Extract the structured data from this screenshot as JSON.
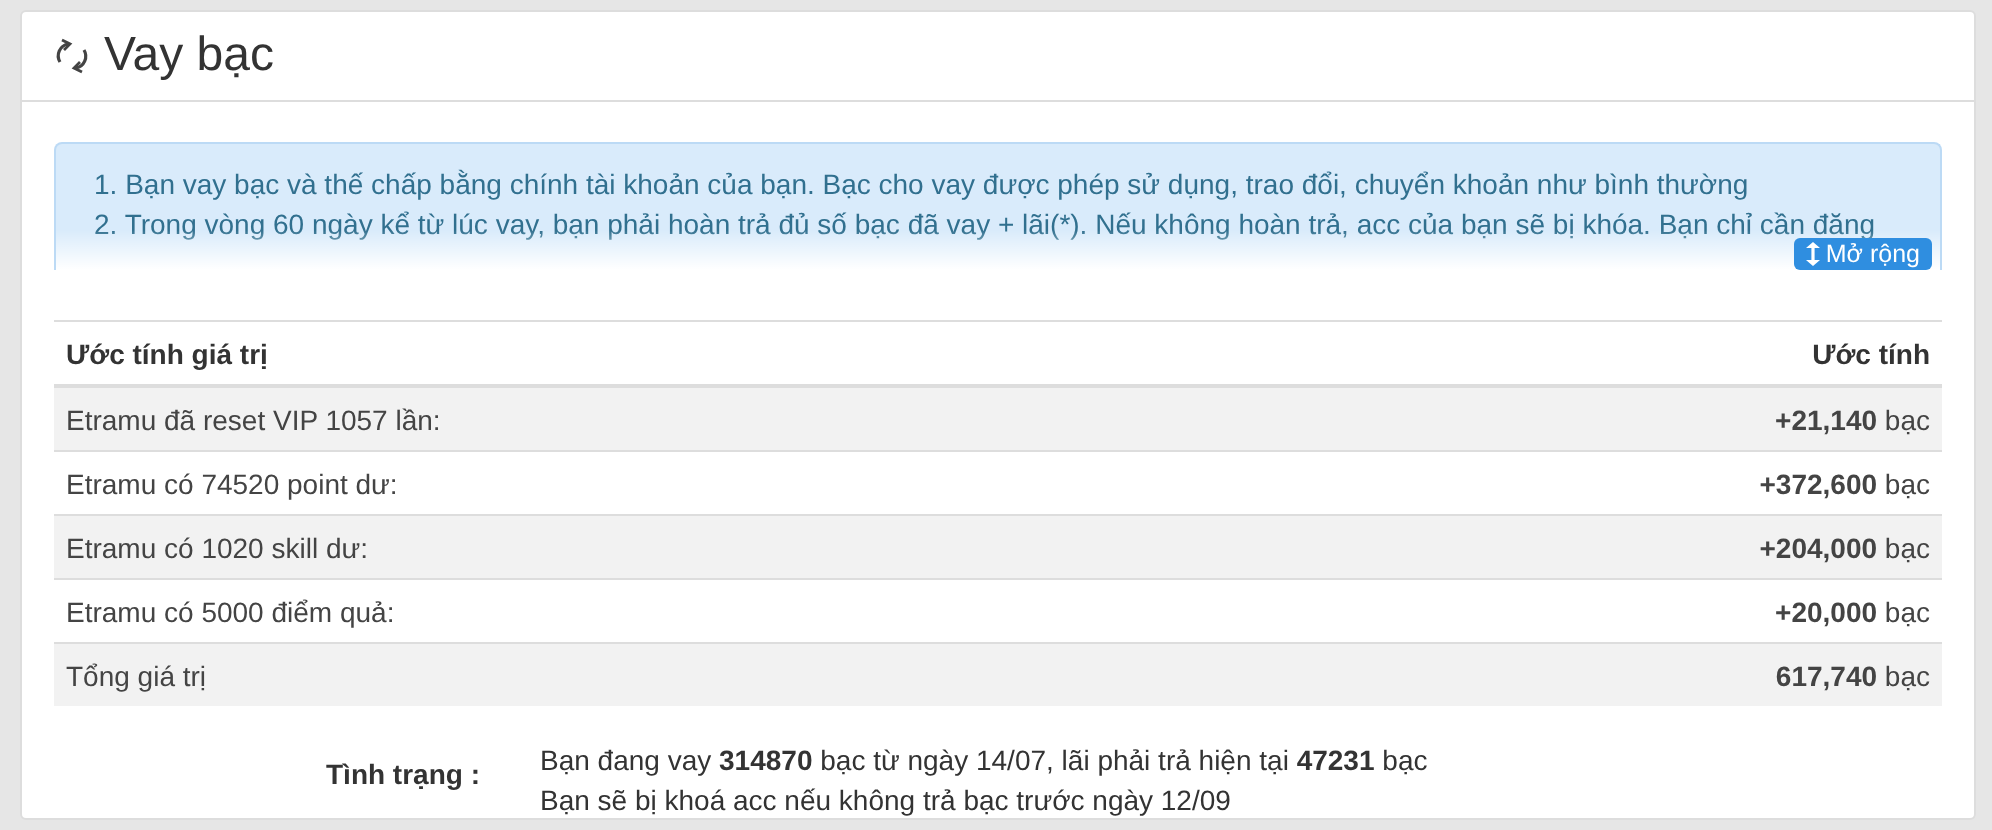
{
  "panel": {
    "title": "Vay bạc"
  },
  "notice": {
    "lines": [
      "1. Bạn vay bạc và thế chấp bằng chính tài khoản của bạn. Bạc cho vay được phép sử dụng, trao đổi, chuyển khoản như bình thường",
      "2. Trong vòng 60 ngày kể từ lúc vay, bạn phải hoàn trả đủ số bạc đã vay + lãi(*). Nếu không hoàn trả, acc của bạn sẽ bị khóa. Bạn chỉ cần đăng"
    ],
    "expand_button": "Mở rộng"
  },
  "table": {
    "columns": [
      "Ước tính giá trị",
      "Ước tính"
    ],
    "rows": [
      {
        "label": "Etramu đã reset VIP 1057 lần:",
        "value": "**+21,140** bạc"
      },
      {
        "label": "Etramu có 74520 point dư:",
        "value": "**+372,600** bạc"
      },
      {
        "label": "Etramu có 1020 skill dư:",
        "value": "**+204,000** bạc"
      },
      {
        "label": "Etramu có 5000 điểm quả:",
        "value": "**+20,000** bạc"
      },
      {
        "label": "Tổng giá trị",
        "value": "**617,740** bạc"
      }
    ]
  },
  "status": {
    "label": "Tình trạng :",
    "lines": [
      "Bạn đang vay **314870** bạc từ ngày 14/07, lãi phải trả hiện tại **47231** bạc",
      "Bạn sẽ bị khoá acc nếu không trả bạc trước ngày 12/09"
    ]
  }
}
